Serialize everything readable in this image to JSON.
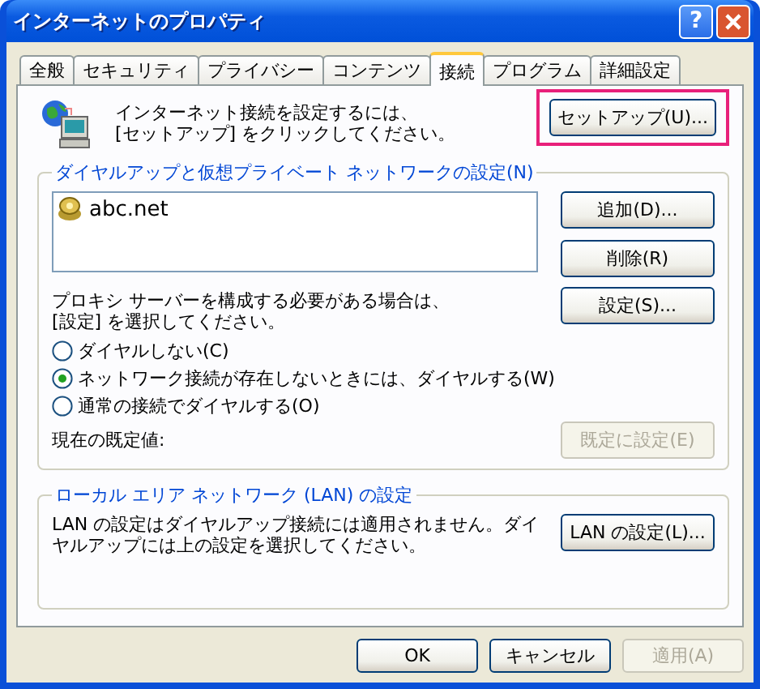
{
  "window": {
    "title": "インターネットのプロパティ",
    "help_label": "?"
  },
  "tabs": [
    {
      "label": "全般",
      "selected": false
    },
    {
      "label": "セキュリティ",
      "selected": false
    },
    {
      "label": "プライバシー",
      "selected": false
    },
    {
      "label": "コンテンツ",
      "selected": false
    },
    {
      "label": "接続",
      "selected": true
    },
    {
      "label": "プログラム",
      "selected": false
    },
    {
      "label": "詳細設定",
      "selected": false
    }
  ],
  "setup": {
    "text": "インターネット接続を設定するには、\n[セットアップ] をクリックしてください。",
    "button": {
      "label": "セットアップ(U)...",
      "highlighted": true,
      "disabled": false
    }
  },
  "dialup": {
    "title": "ダイヤルアップと仮想プライベート ネットワークの設定(N)",
    "connections": [
      {
        "name": "abc.net",
        "selected": false
      }
    ],
    "buttons": [
      {
        "label": "追加(D)...",
        "disabled": false
      },
      {
        "label": "削除(R)",
        "disabled": false
      },
      {
        "label": "設定(S)...",
        "disabled": false
      }
    ],
    "proxy_text": "プロキシ サーバーを構成する必要がある場合は、\n[設定] を選択してください。",
    "options": [
      {
        "label": "ダイヤルしない(C)",
        "selected": false
      },
      {
        "label": "ネットワーク接続が存在しないときには、ダイヤルする(W)",
        "selected": true
      },
      {
        "label": "通常の接続でダイヤルする(O)",
        "selected": false
      }
    ],
    "default_label": "現在の既定値:",
    "default_button": {
      "label": "既定に設定(E)",
      "disabled": true
    }
  },
  "lan": {
    "title": "ローカル エリア ネットワーク (LAN) の設定",
    "text": "LAN の設定はダイヤルアップ接続には適用されません。ダイヤルアップには上の設定を選択してください。",
    "button": {
      "label": "LAN の設定(L)...",
      "disabled": false
    }
  },
  "buttons": [
    {
      "label": "OK",
      "disabled": false
    },
    {
      "label": "キャンセル",
      "disabled": false
    },
    {
      "label": "適用(A)",
      "disabled": true
    }
  ]
}
